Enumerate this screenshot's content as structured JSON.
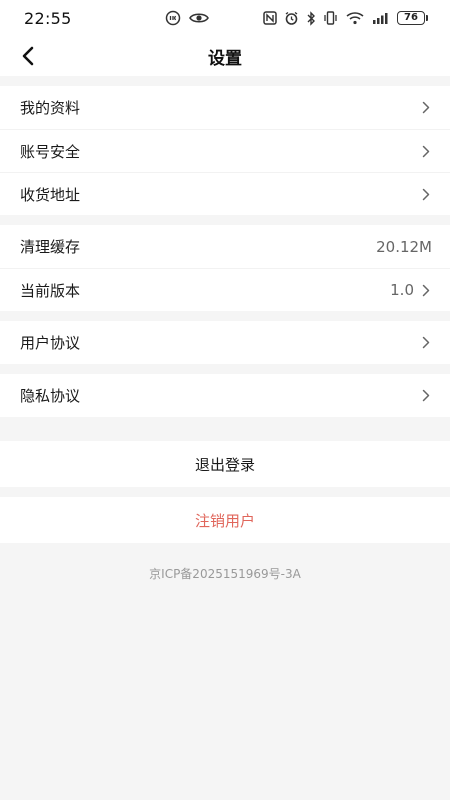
{
  "status_bar": {
    "time": "22:55",
    "battery": "76"
  },
  "header": {
    "title": "设置",
    "back_icon": "chevron-left-icon"
  },
  "groups": [
    {
      "items": [
        {
          "label": "我的资料",
          "value": "",
          "chevron": true
        },
        {
          "label": "账号安全",
          "value": "",
          "chevron": true
        },
        {
          "label": "收货地址",
          "value": "",
          "chevron": true
        }
      ]
    },
    {
      "items": [
        {
          "label": "清理缓存",
          "value": "20.12M",
          "chevron": false
        },
        {
          "label": "当前版本",
          "value": "1.0",
          "chevron": true
        }
      ]
    },
    {
      "items": [
        {
          "label": "用户协议",
          "value": "",
          "chevron": true
        }
      ]
    },
    {
      "items": [
        {
          "label": "隐私协议",
          "value": "",
          "chevron": true
        }
      ]
    }
  ],
  "actions": {
    "logout_label": "退出登录",
    "cancel_account_label": "注销用户"
  },
  "footer": {
    "icp": "京ICP备2025151969号-3A"
  },
  "colors": {
    "background": "#f5f5f5",
    "danger": "#e0665b"
  }
}
